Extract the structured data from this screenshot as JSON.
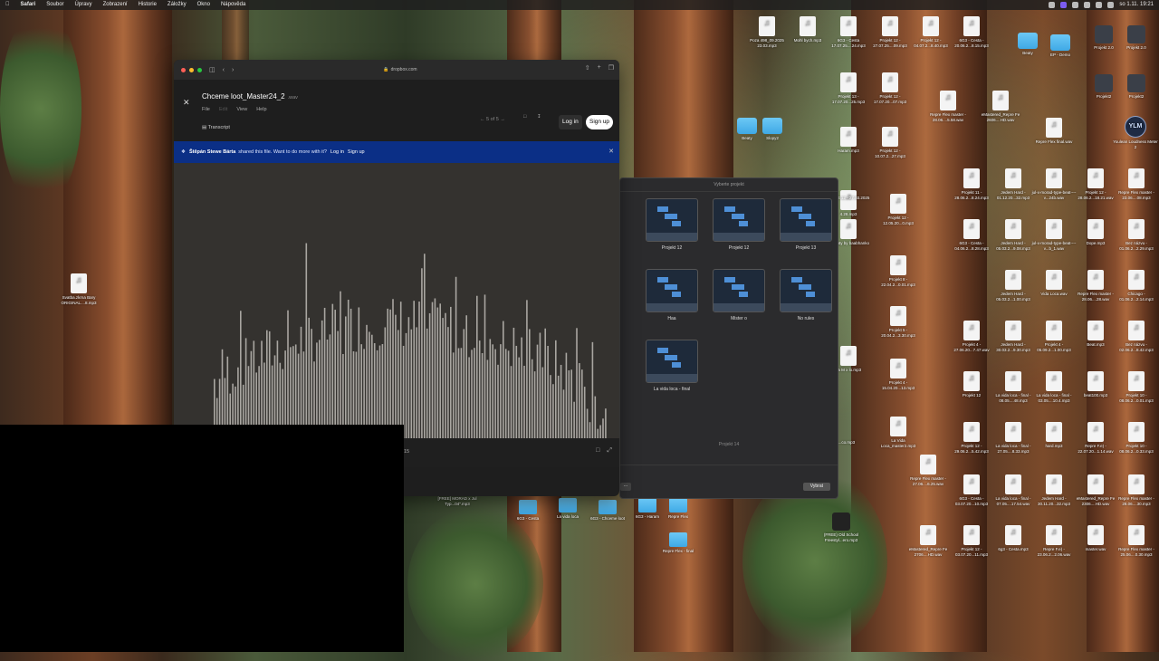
{
  "menubar": {
    "items": [
      "Safari",
      "Soubor",
      "Úpravy",
      "Zobrazení",
      "Historie",
      "Záložky",
      "Okno",
      "Nápověda"
    ],
    "clock": "so 1.11. 19:21"
  },
  "safari": {
    "url": "dropbox.com",
    "file_name": "Chceme loot_Master24_2",
    "file_ext": ".wav",
    "menu": [
      "File",
      "Edit",
      "View",
      "Help"
    ],
    "transcript": "Transcript",
    "pager": "5 of 5",
    "login": "Log in",
    "signup": "Sign up",
    "banner": {
      "user": "Štěpán Stewe Bárta",
      "text": "shared this file. Want to do more with it?",
      "login": "Log in",
      "signup": "Sign up"
    },
    "timecode": "15"
  },
  "picker": {
    "title": "Vyberte projekt",
    "projects": [
      "Projekt 12",
      "Projekt 12",
      "Projekt 13",
      "Haa",
      "Mister o",
      "No rules",
      "La vida loca - final"
    ],
    "selected_name": "Projekt 14",
    "choose": "Vybrat",
    "cancel": "..."
  },
  "desktop": {
    "icons": [
      "Poza 498_09.2025 23.03.mp3",
      "Mohl bych.mp3",
      "6G3 - Cesta 17.07.25....24.mp3",
      "Projekt 12 - 27.07.25....09.mp3",
      "Projekt 12 - 04.07.2...8.40.mp3",
      "6G3 - Cesta - 20.06.2...8.15.mp3",
      "Beaty",
      "EP - Demo",
      "Projekt 2.0",
      "Projekt 2.0",
      "Projekt 13 - 17.07.20...25.mp3",
      "Projekt 12 - 17.07.20...07.mp3",
      "Repre Flex master - 28.06....5.58.wav",
      "eMastered_Repre Fe 2606....HD.wav",
      "Projekt2",
      "Projekt2",
      "Youlean Loudness Meter 2",
      "Repre Flex final.wav",
      "Haram.mp3",
      "Projekt 12 - 10.07.2...27.mp3",
      "Beaty",
      "Slopy2",
      "Projekt 11 - 28.06.2...8.24.mp3",
      "Jedem Hard - 01.12.20...32.mp3",
      "jul-x-morad-type-beat----v...24b.wav",
      "Projekt 12 - 28.06.2...18.21.wav",
      "Repre Flex master - 23.06....08.mp3",
      "6G3 - Cesta - 04.06.2...8.28.mp3",
      "Jedem Hard - 05.03.2...9.08.mp3",
      "jul-x-morad-type-beat----v...b_1.wav",
      "Dope.mp3",
      "Bez názvu - 01.06.2...2.29.mp3",
      "Projekt 12 - 12.05.20...0.mp3",
      "Projekt 8 - 22.04.2...0.01.mp3",
      "Projekt 5 - 20.04.2...3.30.mp3",
      "Projekt 4 - 15.04.20...13.mp3",
      "La Vida Loca_master2.mp3",
      "Jedem Hard - 05.03.2...1.00.mp3",
      "Vida Loca.wav",
      "Repre Flex master - 28.06....28.wav",
      "Chicago - 01.06.2...2.14.mp3",
      "Projekt 4 - 27.06.20...7.47.wav",
      "Jedem Hard - 30.03.2...9.30.mp3",
      "Projekt 4 - 05.09.2...1.00.mp3",
      "Beat.mp3",
      "Bez názvu - 02.06.2...8.42.mp3",
      "Projekt 12",
      "La vida loca - final - 08.05....48.mp3",
      "La vida loca - final - 03.05....10.4.mp3",
      "beat100.mp3",
      "Projekt 10 - 08.06.2...0.01.mp3",
      "Projekt 12 - 29.06.2...5.42.mp3",
      "La vida loca - final - 27.05....8.33.mp3",
      "hard.mp3",
      "Repre F.e) - 22.07.20...1.14.wav",
      "Projekt 10 - 08.06.2...0.33.mp3",
      "6G3 - Cesta - 03.07.20...10.mp3",
      "La vida loca - final - 07.05....17.54.wav",
      "Jedem Hard - 30.11.20...32.mp3",
      "eMastered_Repre Fe 2306....HD.wav",
      "Repre Flex master - 28.06....30.mp3",
      "Repre Flex master - 27.06....6.25.wav",
      "eMastered_Repre Fe 2706....HD.wav",
      "Projekt 12 - 03.07.20...11.mp3",
      "6g3 - Cesta.mp3",
      "Repre F.e) - 23.06.2...2.06.wav",
      "master.wav",
      "Repre Flex master - 25.06....0.30.mp3",
      "Svatba.zkrna Bary ORIGINAL....8.mp3",
      "4.28.mp3",
      "Khoopty by baabhanko",
      "La M x lo.mp3",
      "sh a ...co.mp3",
      "[FREE] MORAD x Jul Typ...04\".mp3",
      "6G3 - Cesta",
      "La vida loca",
      "6G3 - Chceme loot",
      "6G3 - Haram",
      "Repre Flex",
      "Repre Flex - final",
      "(FREE) Old School Freestyl...ero.mp3",
      "Projekt 12 - 27.03.2025"
    ]
  }
}
